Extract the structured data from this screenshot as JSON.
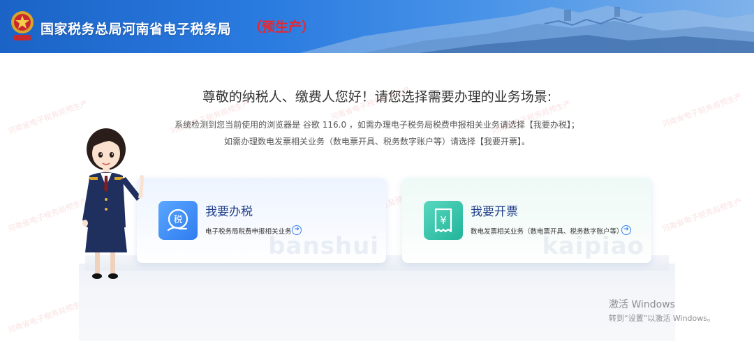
{
  "header": {
    "title": "国家税务总局河南省电子税务局",
    "env_tag": "（预生产）"
  },
  "watermark_text": "河南省电子税务局预生产",
  "greeting": {
    "title": "尊敬的纳税人、缴费人您好！请您选择需要办理的业务场景:",
    "line1": "系统检测到您当前使用的浏览器是 谷歌 116.0 ，如需办理电子税务局税费申报相关业务请选择【我要办税】；",
    "line2": "如需办理数电发票相关业务（数电票开具、税务数字账户等）请选择【我要开票】。"
  },
  "cards": {
    "banshui": {
      "title": "我要办税",
      "description": "电子税务局税费申报相关业务",
      "icon_glyph": "税",
      "watermark": "banshui"
    },
    "kaipiao": {
      "title": "我要开票",
      "description": "数电发票相关业务（数电票开具、税务数字账户等）",
      "icon_glyph": "¥",
      "watermark": "kaipiao"
    }
  },
  "activation": {
    "title": "激活 Windows",
    "subtitle": "转到“设置”以激活 Windows。"
  },
  "colors": {
    "header_blue": "#1b63c6",
    "env_red": "#e8262d",
    "banshui_blue": "#2f7cf0",
    "kaipiao_green": "#22b49a"
  }
}
